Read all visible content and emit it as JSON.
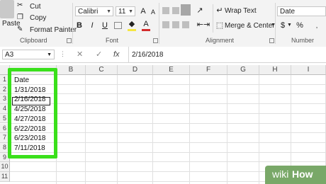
{
  "ribbon": {
    "clipboard": {
      "paste": "Paste",
      "cut": "Cut",
      "copy": "Copy",
      "format_painter": "Format Painter",
      "group": "Clipboard"
    },
    "font": {
      "name": "Calibri",
      "size": "11",
      "bold": "B",
      "italic": "I",
      "underline": "U",
      "group": "Font"
    },
    "alignment": {
      "wrap_text": "Wrap Text",
      "merge_center": "Merge & Center",
      "group": "Alignment"
    },
    "number": {
      "format": "Date",
      "currency": "$",
      "percent": "%",
      "group": "Number"
    },
    "colors": {
      "fill": "#f5e642",
      "font": "#d32b2b"
    }
  },
  "formula_bar": {
    "name_box": "A3",
    "fx": "fx",
    "value": "2/16/2018"
  },
  "grid": {
    "columns": [
      "B",
      "C",
      "D",
      "E",
      "F",
      "G",
      "H",
      "I"
    ],
    "rows": [
      "1",
      "2",
      "3",
      "4",
      "5",
      "6",
      "7",
      "8",
      "9",
      "10",
      "11"
    ],
    "cells_a": [
      "Date",
      "1/31/2018",
      "2/16/2018",
      "4/25/2018",
      "4/27/2018",
      "6/22/2018",
      "6/23/2018",
      "7/11/2018"
    ]
  },
  "watermark": {
    "wiki": "wiki",
    "how": "How"
  },
  "colors": {
    "highlight": "#3ae01b",
    "watermark": "#79a868"
  }
}
